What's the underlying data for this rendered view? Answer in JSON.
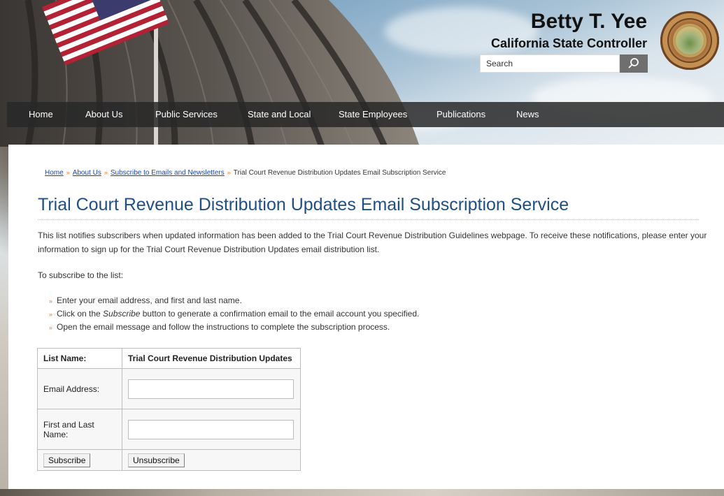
{
  "header": {
    "name": "Betty T. Yee",
    "title": "California State Controller",
    "seal_icon": "state-controller-seal-icon",
    "search": {
      "placeholder": "Search",
      "icon": "search-icon"
    }
  },
  "nav": {
    "items": [
      {
        "label": "Home"
      },
      {
        "label": "About Us"
      },
      {
        "label": "Public Services"
      },
      {
        "label": "State and Local"
      },
      {
        "label": "State Employees"
      },
      {
        "label": "Publications"
      },
      {
        "label": "News"
      }
    ]
  },
  "breadcrumb": {
    "items": [
      {
        "label": "Home"
      },
      {
        "label": "About Us"
      },
      {
        "label": "Subscribe to Emails and Newsletters"
      }
    ],
    "current": "Trial Court Revenue Distribution Updates Email Subscription Service",
    "separator": "»"
  },
  "main": {
    "title": "Trial Court Revenue Distribution Updates Email Subscription Service",
    "intro": "This list notifies subscribers when updated information has been added to the Trial Court Revenue Distribution Guidelines webpage. To receive these notifications, please enter your information to sign up for the Trial Court Revenue Distribution Updates email distribution list.",
    "lead": "To subscribe to the list:",
    "steps": [
      {
        "before": "Enter your email address, and first and last name.",
        "em": "",
        "after": ""
      },
      {
        "before": "Click on the ",
        "em": "Subscribe",
        "after": " button to generate a confirmation email to the email account you specified."
      },
      {
        "before": "Open the email message and follow the instructions to complete the subscription process.",
        "em": "",
        "after": ""
      }
    ]
  },
  "form": {
    "list_name_label": "List Name:",
    "list_name_value": "Trial Court Revenue Distribution Updates",
    "email_label": "Email Address:",
    "email_value": "",
    "name_label": "First and Last Name:",
    "name_value": "",
    "subscribe_label": "Subscribe",
    "unsubscribe_label": "Unsubscribe"
  },
  "colors": {
    "title": "#1f4f86",
    "link": "#1a46b8",
    "bullet": "#e07a2c",
    "nav_bg": "#2a2a2a"
  }
}
